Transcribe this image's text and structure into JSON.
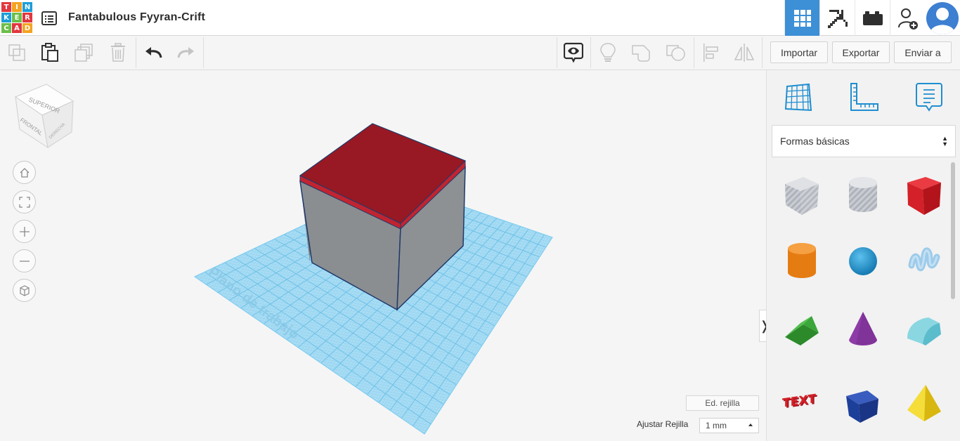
{
  "app": {
    "logo_letters": [
      "T",
      "I",
      "N",
      "K",
      "E",
      "R",
      "C",
      "A",
      "D"
    ],
    "title": "Fantabulous Fyyran-Crift"
  },
  "top_tabs": [
    {
      "name": "3d-design",
      "icon": "grid-icon",
      "active": true
    },
    {
      "name": "blocks",
      "icon": "pickaxe-icon",
      "active": false
    },
    {
      "name": "bricks",
      "icon": "brick-icon",
      "active": false
    },
    {
      "name": "invite",
      "icon": "add-user-icon",
      "active": false
    }
  ],
  "toolbar": {
    "import_label": "Importar",
    "export_label": "Exportar",
    "send_label": "Enviar a"
  },
  "view_cube": {
    "top": "SUPERIOR",
    "front": "FRONTAL",
    "right": "DERECHA"
  },
  "workplane": {
    "label": "Plano de trabajo"
  },
  "grid": {
    "edit_label": "Ed. rejilla",
    "snap_label": "Ajustar Rejilla",
    "snap_value": "1 mm"
  },
  "panel": {
    "category": "Formas básicas",
    "shapes": [
      {
        "name": "box-hole",
        "color": "#b8bcc4"
      },
      {
        "name": "cylinder-hole",
        "color": "#c0c4cb"
      },
      {
        "name": "box",
        "color": "#d42028"
      },
      {
        "name": "cylinder",
        "color": "#f08a1c"
      },
      {
        "name": "sphere",
        "color": "#1f95d0"
      },
      {
        "name": "scribble",
        "color": "#8fc3e6"
      },
      {
        "name": "roof",
        "color": "#3ba63a"
      },
      {
        "name": "cone",
        "color": "#8e3ba8"
      },
      {
        "name": "round-roof",
        "color": "#5bbccc"
      },
      {
        "name": "text",
        "color": "#c92028"
      },
      {
        "name": "prism",
        "color": "#1c3f9a"
      },
      {
        "name": "pyramid",
        "color": "#f2d21c"
      }
    ]
  },
  "colors": {
    "accent": "#3d8fd6",
    "box_top": "#9b1a23",
    "box_side": "#8a8e91",
    "grid": "#7fcdf0"
  }
}
